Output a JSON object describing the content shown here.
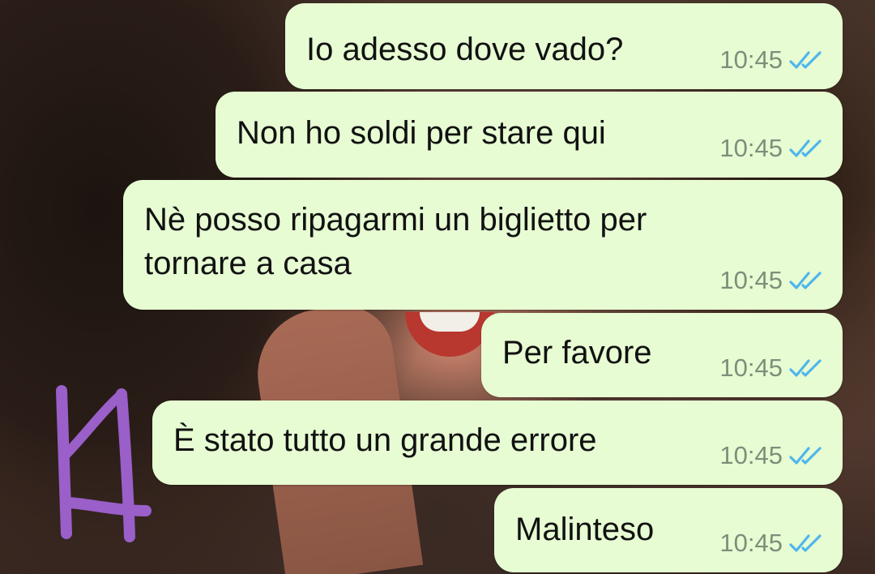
{
  "chat": {
    "bubble_color": "#e7fcd3",
    "tick_color": "#4fb6ec",
    "messages": [
      {
        "text": "Io adesso dove vado?",
        "time": "10:45",
        "status": "read"
      },
      {
        "text": "Non ho soldi per stare qui",
        "time": "10:45",
        "status": "read"
      },
      {
        "text": "Nè posso ripagarmi un biglietto per\ntornare a casa",
        "time": "10:45",
        "status": "read"
      },
      {
        "text": "Per favore",
        "time": "10:45",
        "status": "read"
      },
      {
        "text": "È stato tutto un grande errore",
        "time": "10:45",
        "status": "read"
      },
      {
        "text": "Malinteso",
        "time": "10:45",
        "status": "read"
      }
    ]
  },
  "annotation": {
    "icon": "handwritten-k-mark",
    "color": "#9a5fc9"
  }
}
